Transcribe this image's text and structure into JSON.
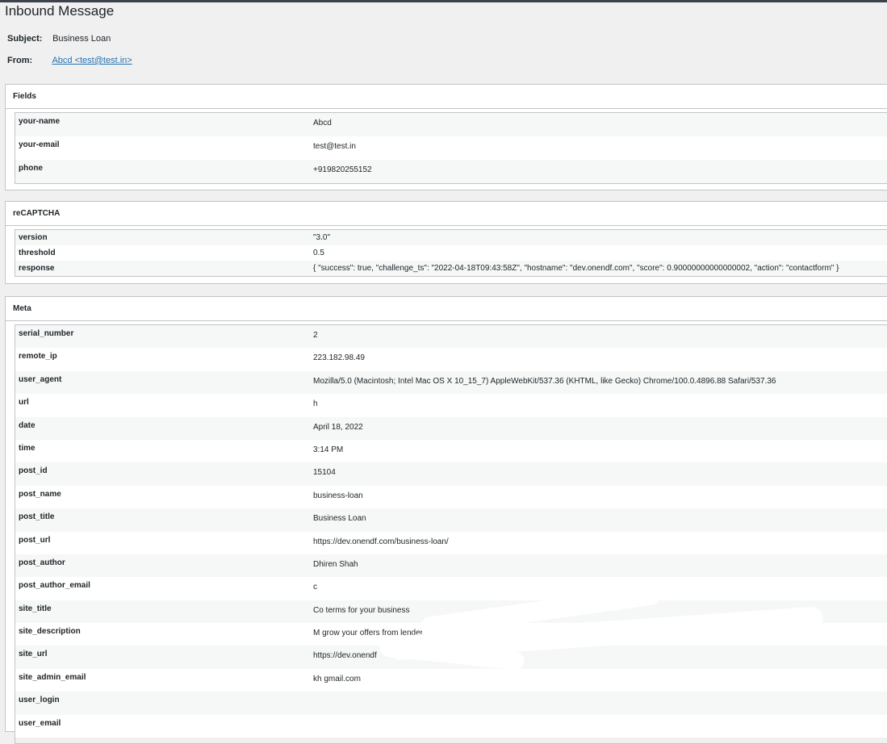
{
  "page": {
    "title": "Inbound Message"
  },
  "header": {
    "subject_label": "Subject:",
    "subject_value": "Business Loan",
    "from_label": "From:",
    "from_value": "Abcd <test@test.in>"
  },
  "fields": {
    "title": "Fields",
    "rows": [
      {
        "key": "your-name",
        "value": "Abcd"
      },
      {
        "key": "your-email",
        "value": "test@test.in"
      },
      {
        "key": "phone",
        "value": "+919820255152"
      }
    ]
  },
  "recaptcha": {
    "title": "reCAPTCHA",
    "rows": [
      {
        "key": "version",
        "value": "\"3.0\""
      },
      {
        "key": "threshold",
        "value": "0.5"
      },
      {
        "key": "response",
        "value": "{ \"success\": true, \"challenge_ts\": \"2022-04-18T09:43:58Z\", \"hostname\": \"dev.onendf.com\", \"score\": 0.90000000000000002, \"action\": \"contactform\" }"
      }
    ]
  },
  "meta": {
    "title": "Meta",
    "rows": [
      {
        "key": "serial_number",
        "value": "2"
      },
      {
        "key": "remote_ip",
        "value": "223.182.98.49"
      },
      {
        "key": "user_agent",
        "value": "Mozilla/5.0 (Macintosh; Intel Mac OS X 10_15_7) AppleWebKit/537.36 (KHTML, like Gecko) Chrome/100.0.4896.88 Safari/537.36"
      },
      {
        "key": "url",
        "value": "h"
      },
      {
        "key": "date",
        "value": "April 18, 2022"
      },
      {
        "key": "time",
        "value": "3:14 PM"
      },
      {
        "key": "post_id",
        "value": "15104"
      },
      {
        "key": "post_name",
        "value": "business-loan"
      },
      {
        "key": "post_title",
        "value": "Business Loan"
      },
      {
        "key": "post_url",
        "value": "https://dev.onendf.com/business-loan/"
      },
      {
        "key": "post_author",
        "value": "Dhiren Shah"
      },
      {
        "key": "post_author_email",
        "value": "c"
      },
      {
        "key": "site_title",
        "value": "Co                  terms for your business"
      },
      {
        "key": "site_description",
        "value": "M                           grow your                                   offers from lenders"
      },
      {
        "key": "site_url",
        "value": "https://dev.onendf"
      },
      {
        "key": "site_admin_email",
        "value": "kh                          gmail.com"
      },
      {
        "key": "user_login",
        "value": ""
      },
      {
        "key": "user_email",
        "value": ""
      }
    ]
  }
}
